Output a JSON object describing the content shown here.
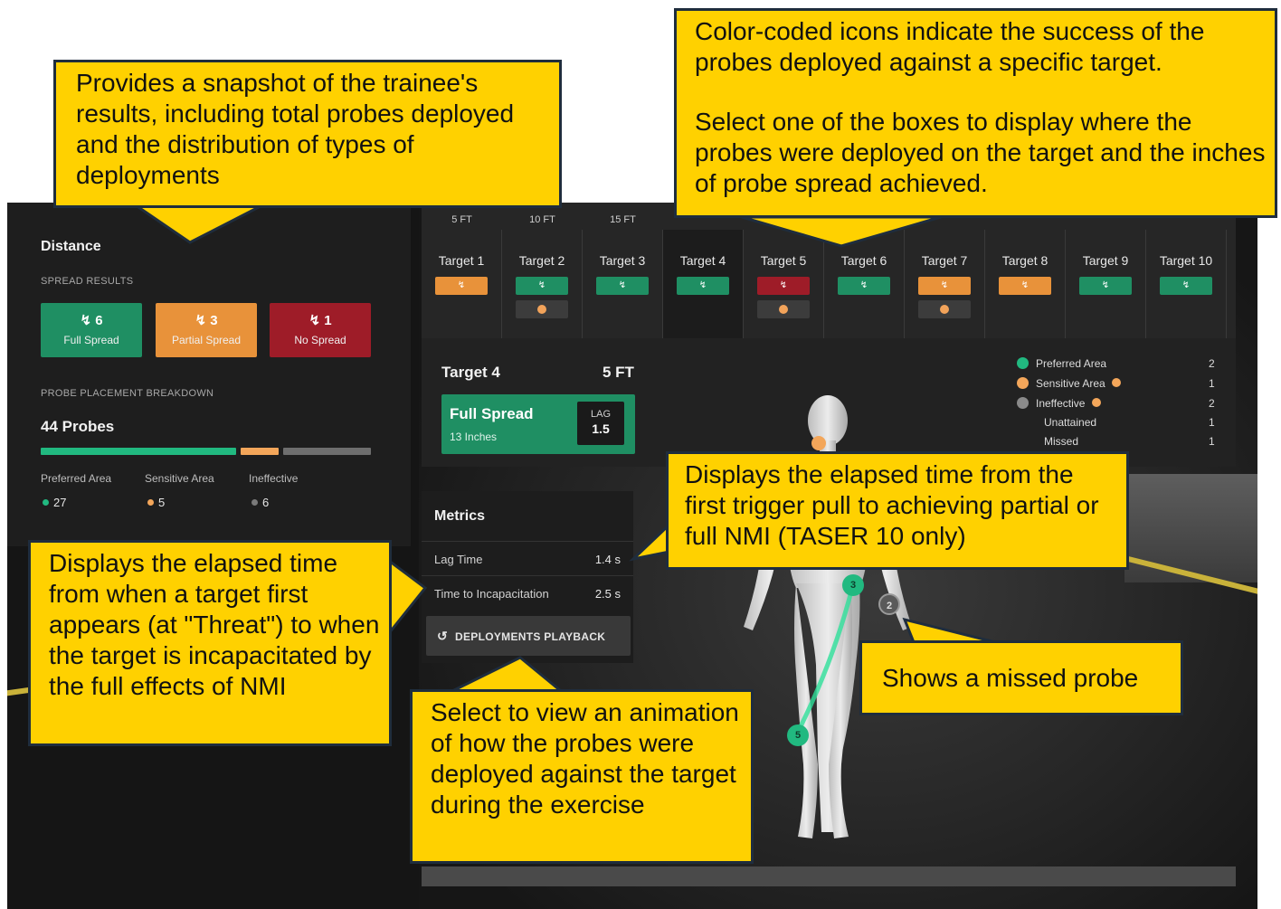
{
  "left_panel": {
    "title": "Distance",
    "spread_results_label": "SPREAD RESULTS",
    "spread": [
      {
        "icon": "lightning-icon",
        "count": "6",
        "label": "Full Spread",
        "color": "#1f8f63"
      },
      {
        "icon": "lightning-icon",
        "count": "3",
        "label": "Partial Spread",
        "color": "#e8923a"
      },
      {
        "icon": "lightning-icon",
        "count": "1",
        "label": "No Spread",
        "color": "#9e1c28"
      }
    ],
    "breakdown_label": "PROBE PLACEMENT BREAKDOWN",
    "probes_total": "44 Probes",
    "breakdown": [
      {
        "label": "Preferred Area",
        "value": "27",
        "fraction": 0.614,
        "color": "#21b980"
      },
      {
        "label": "Sensitive Area",
        "value": "5",
        "fraction": 0.114,
        "color": "#f3a65a"
      },
      {
        "label": "Ineffective",
        "value": "6",
        "fraction": 0.136,
        "color": "#7a7a7a"
      }
    ]
  },
  "target_grid": {
    "distances": [
      "5 FT",
      "10 FT",
      "15 FT"
    ],
    "targets": [
      {
        "name": "Target 1",
        "status": "partial",
        "color": "#e8923a",
        "missed": false
      },
      {
        "name": "Target 2",
        "status": "full",
        "color": "#1f8f63",
        "missed": true
      },
      {
        "name": "Target 3",
        "status": "full",
        "color": "#1f8f63",
        "missed": false
      },
      {
        "name": "Target 4",
        "status": "full",
        "color": "#1f8f63",
        "missed": false
      },
      {
        "name": "Target 5",
        "status": "none",
        "color": "#9e1c28",
        "missed": true
      },
      {
        "name": "Target 6",
        "status": "full",
        "color": "#1f8f63",
        "missed": false
      },
      {
        "name": "Target 7",
        "status": "partial",
        "color": "#e8923a",
        "missed": true
      },
      {
        "name": "Target 8",
        "status": "partial",
        "color": "#e8923a",
        "missed": false
      },
      {
        "name": "Target 9",
        "status": "full",
        "color": "#1f8f63",
        "missed": false
      },
      {
        "name": "Target 10",
        "status": "full",
        "color": "#1f8f63",
        "missed": false
      }
    ],
    "badge_icon": "lightning-icon"
  },
  "target_detail": {
    "title": "Target 4",
    "distance": "5 FT",
    "result": "Full Spread",
    "spread_inches": "13 Inches",
    "lag_label": "LAG",
    "lag_value": "1.5",
    "areas": [
      {
        "label": "Preferred Area",
        "value": "2",
        "color": "#21b980"
      },
      {
        "label": "Sensitive Area",
        "value": "1",
        "color": "#f3a65a"
      },
      {
        "label": "Ineffective",
        "value": "2",
        "color": "#8a8a8a"
      },
      {
        "label": "Unattained",
        "value": "1"
      },
      {
        "label": "Missed",
        "value": "1"
      }
    ]
  },
  "metrics": {
    "title": "Metrics",
    "lag_time_label": "Lag Time",
    "lag_time_value": "1.4 s",
    "tti_label": "Time to Incapacitation",
    "tti_value": "2.5 s",
    "playback_label": "DEPLOYMENTS PLAYBACK"
  },
  "figure_markers": [
    "3",
    "2",
    "5"
  ],
  "callouts": {
    "snapshot": "Provides a snapshot of the trainee's results, including total probes deployed and the distribution of types of deployments",
    "color_coded_1": "Color-coded icons indicate the success of the probes deployed against a specific target.",
    "color_coded_2": "Select one of the boxes to display where the probes were deployed on the target and the inches of probe spread achieved.",
    "lag": "Displays the elapsed time from the first trigger pull to achieving partial or full NMI (TASER 10 only)",
    "tti": "Displays the elapsed time from when a target first appears (at \"Threat\") to when the target is incapacitated by the full effects of NMI",
    "missed": "Shows a missed probe",
    "playback": "Select to view an animation of how the probes were deployed against the target during the exercise"
  }
}
